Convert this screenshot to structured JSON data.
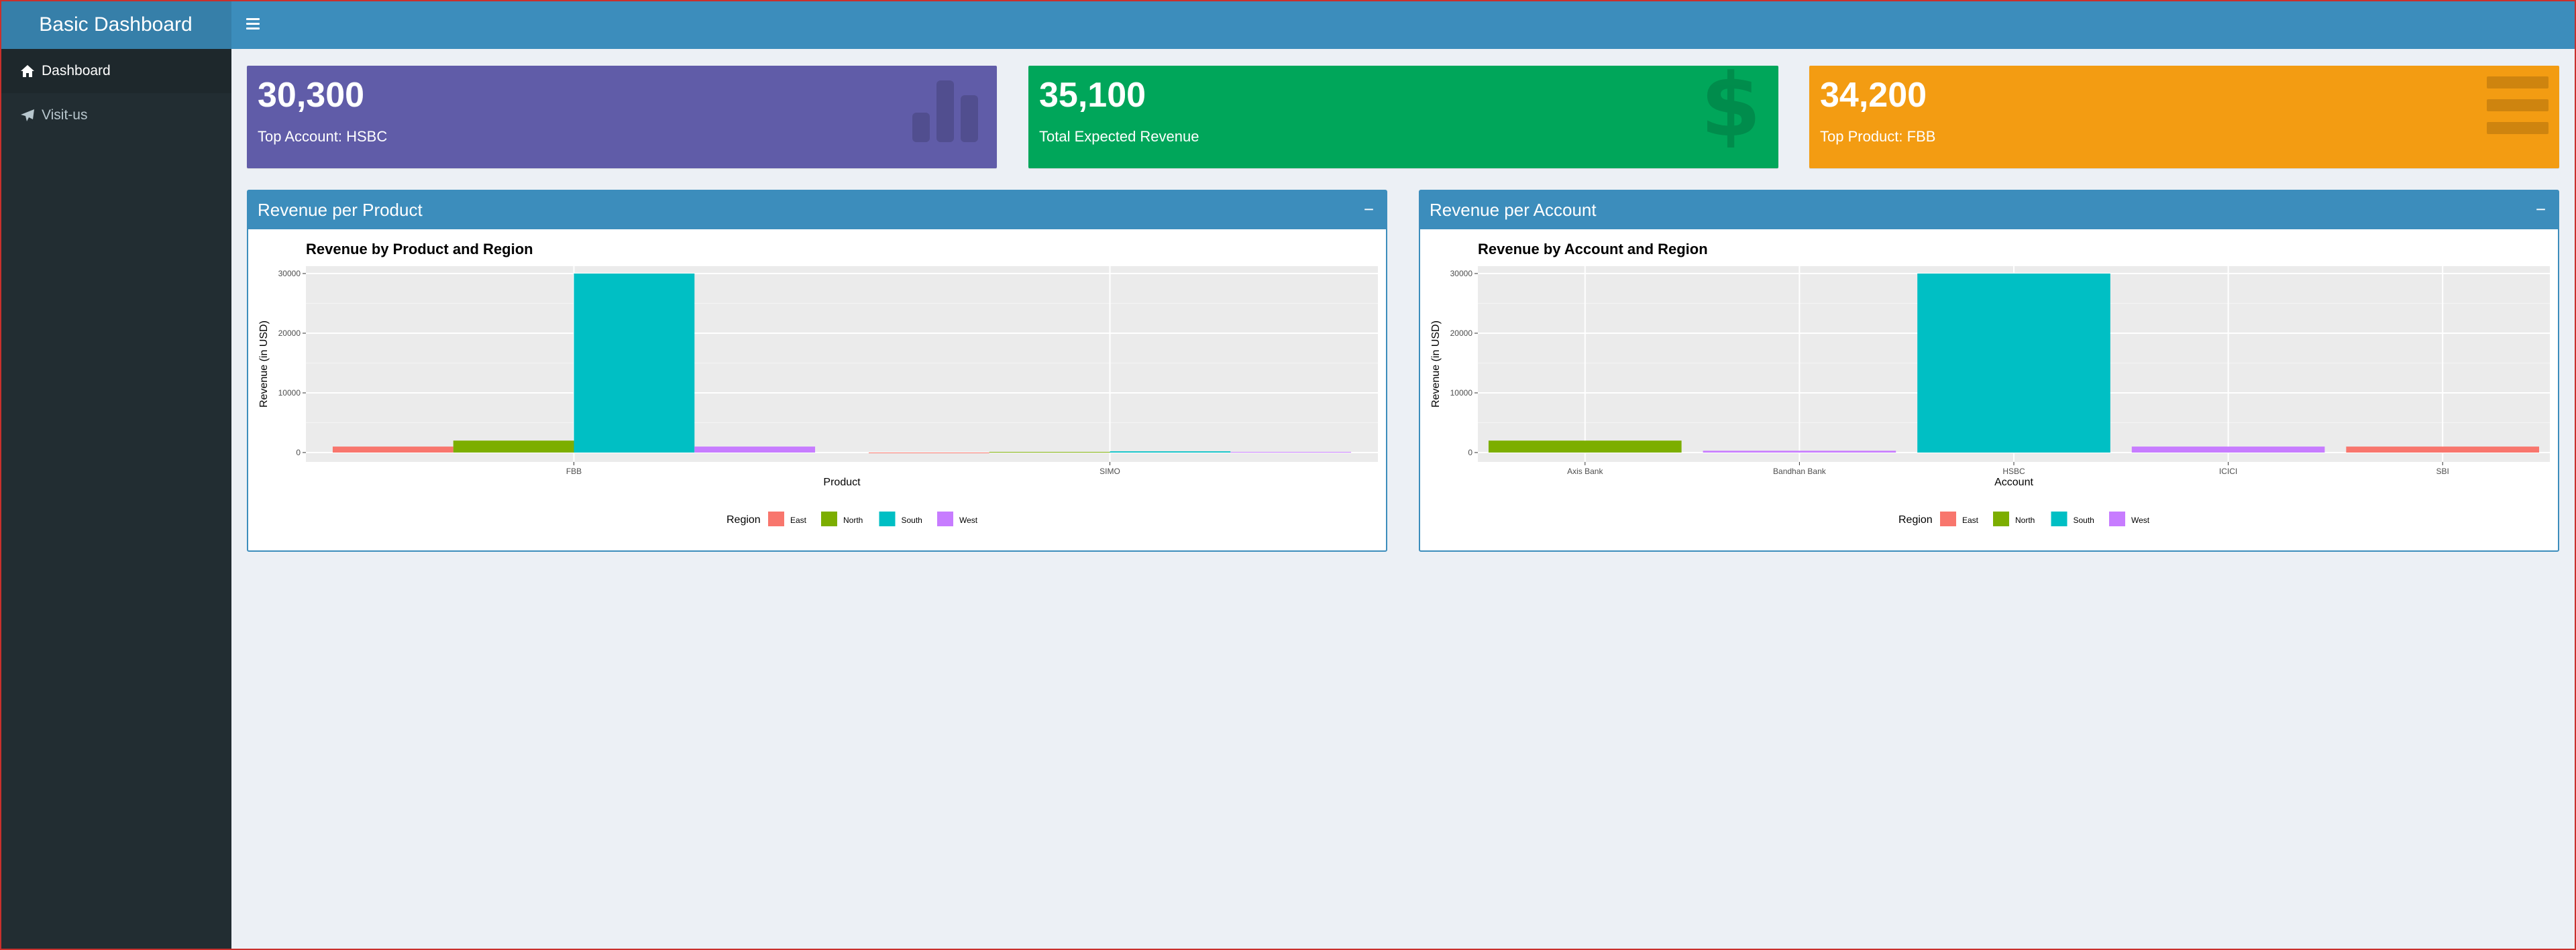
{
  "app": {
    "title": "Basic Dashboard"
  },
  "navbar": {
    "toggle_icon": "hamburger-icon"
  },
  "sidebar": {
    "items": [
      {
        "label": "Dashboard",
        "icon": "home-icon",
        "active": true
      },
      {
        "label": "Visit-us",
        "icon": "paper-plane-icon",
        "active": false
      }
    ]
  },
  "value_boxes": [
    {
      "value": "30,300",
      "subtitle": "Top Account: HSBC",
      "color": "#605ca8",
      "icon": "bar-chart-icon"
    },
    {
      "value": "35,100",
      "subtitle": "Total Expected Revenue",
      "color": "#00a65a",
      "icon": "dollar-icon"
    },
    {
      "value": "34,200",
      "subtitle": "Top Product: FBB",
      "color": "#f39c12",
      "icon": "menu-icon"
    }
  ],
  "panels": [
    {
      "title": "Revenue per Product",
      "collapse_label": "−"
    },
    {
      "title": "Revenue per Account",
      "collapse_label": "−"
    }
  ],
  "colors": {
    "East": "#f8766d",
    "North": "#7cae00",
    "South": "#00bfc4",
    "West": "#c77cff"
  },
  "chart_data": [
    {
      "type": "bar",
      "title": "Revenue by Product and Region",
      "xlabel": "Product",
      "ylabel": "Revenue (in USD)",
      "categories": [
        "FBB",
        "SIMO"
      ],
      "yticks": [
        0,
        10000,
        20000,
        30000
      ],
      "ylim": [
        0,
        30000
      ],
      "legend_title": "Region",
      "legend_position": "bottom",
      "grid": true,
      "series": [
        {
          "name": "East",
          "values": [
            1000,
            0
          ]
        },
        {
          "name": "North",
          "values": [
            2000,
            100
          ]
        },
        {
          "name": "South",
          "values": [
            30000,
            200
          ]
        },
        {
          "name": "West",
          "values": [
            1000,
            100
          ]
        }
      ]
    },
    {
      "type": "bar",
      "title": "Revenue by Account and Region",
      "xlabel": "Account",
      "ylabel": "Revenue (in USD)",
      "categories": [
        "Axis Bank",
        "Bandhan Bank",
        "HSBC",
        "ICICI",
        "SBI"
      ],
      "yticks": [
        0,
        10000,
        20000,
        30000
      ],
      "ylim": [
        0,
        30000
      ],
      "legend_title": "Region",
      "legend_position": "bottom",
      "grid": true,
      "bars": [
        {
          "category": "Axis Bank",
          "region": "North",
          "value": 2000
        },
        {
          "category": "Bandhan Bank",
          "region": "West",
          "value": 300
        },
        {
          "category": "HSBC",
          "region": "South",
          "value": 30000
        },
        {
          "category": "ICICI",
          "region": "West",
          "value": 1000
        },
        {
          "category": "SBI",
          "region": "East",
          "value": 1000
        }
      ]
    }
  ]
}
